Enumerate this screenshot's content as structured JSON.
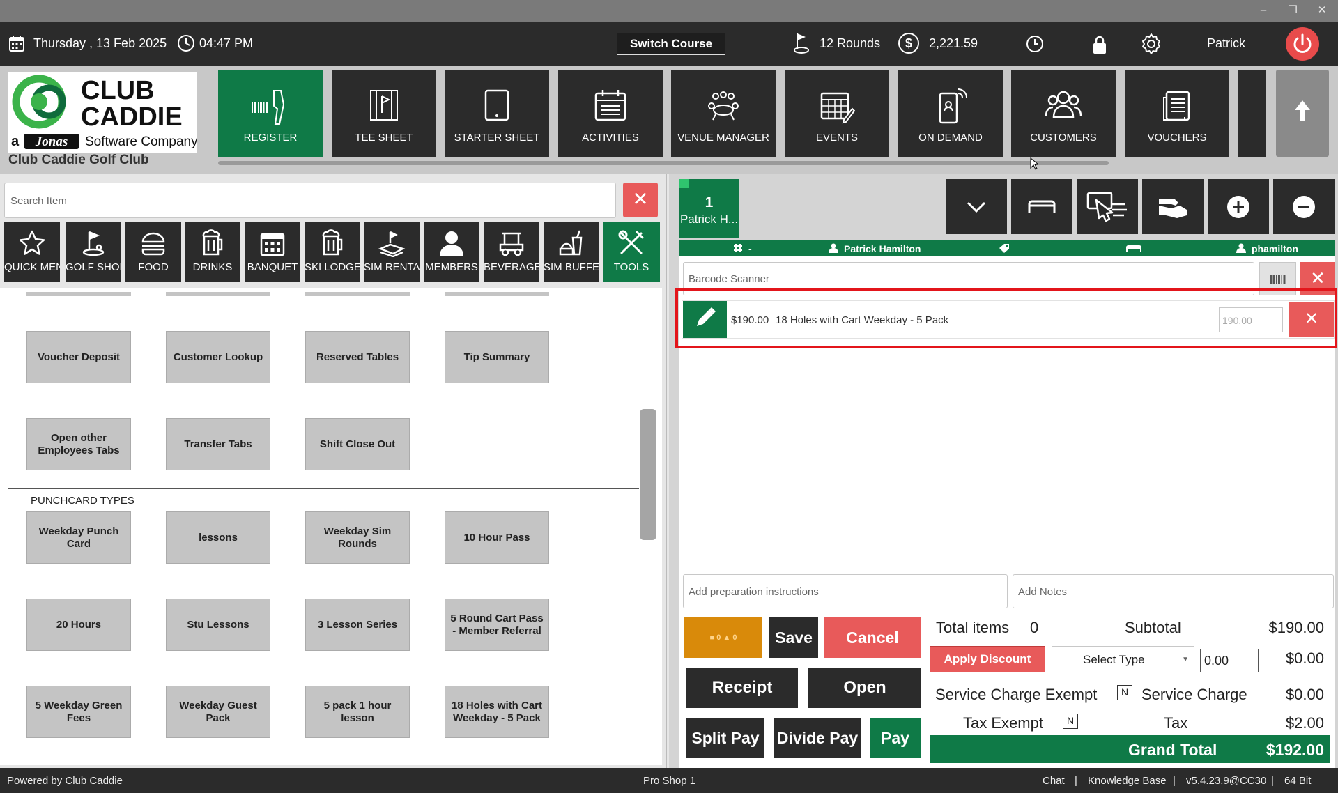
{
  "topbar": {
    "date": "Thursday ,  13 Feb 2025",
    "time": "04:47 PM",
    "switch_course": "Switch Course",
    "rounds": "12 Rounds",
    "amount": "2,221.59",
    "user": "Patrick"
  },
  "logo": {
    "line1": "CLUB",
    "line2": "CADDIE",
    "tagline_a": "a",
    "tagline_brand": "Jonas",
    "tagline_rest": "Software Company"
  },
  "club_name": "Club Caddie Golf Club",
  "nav": [
    {
      "label": "REGISTER",
      "icon": "barcode-scanner-icon"
    },
    {
      "label": "TEE SHEET",
      "icon": "flag-sheet-icon"
    },
    {
      "label": "STARTER SHEET",
      "icon": "tablet-icon"
    },
    {
      "label": "ACTIVITIES",
      "icon": "calendar-list-icon"
    },
    {
      "label": "VENUE MANAGER",
      "icon": "meeting-table-icon"
    },
    {
      "label": "EVENTS",
      "icon": "calendar-edit-icon"
    },
    {
      "label": "ON DEMAND",
      "icon": "mobile-signal-icon"
    },
    {
      "label": "CUSTOMERS",
      "icon": "people-group-icon"
    },
    {
      "label": "VOUCHERS",
      "icon": "voucher-list-icon"
    }
  ],
  "search": {
    "placeholder": "Search Item"
  },
  "categories": [
    {
      "label": "QUICK MENU",
      "icon": "star-icon"
    },
    {
      "label": "GOLF SHOP",
      "icon": "golf-icon"
    },
    {
      "label": "FOOD",
      "icon": "burger-icon"
    },
    {
      "label": "DRINKS",
      "icon": "beer-mug-icon"
    },
    {
      "label": "BANQUET",
      "icon": "calendar-grid-icon"
    },
    {
      "label": "SKI LODGE",
      "icon": "beer-mug-icon"
    },
    {
      "label": "SIM RENTAL",
      "icon": "sim-icon"
    },
    {
      "label": "MEMBERS",
      "icon": "person-icon"
    },
    {
      "label": "BEVERAGE",
      "icon": "golf-cart-icon"
    },
    {
      "label": "SIM BUFFET",
      "icon": "buffet-icon"
    },
    {
      "label": "TOOLS",
      "icon": "tools-icon"
    }
  ],
  "tools": [
    "Voucher Deposit",
    "Customer Lookup",
    "Reserved Tables",
    "Tip Summary",
    "Open other Employees Tabs",
    "Transfer Tabs",
    "Shift Close Out"
  ],
  "punchcard_label": "PUNCHCARD TYPES",
  "punchcards": [
    "Weekday Punch Card",
    "lessons",
    "Weekday Sim Rounds",
    "10 Hour Pass",
    "20 Hours",
    "Stu Lessons",
    "3 Lesson Series",
    "5 Round Cart Pass - Member Referral",
    "5 Weekday Green Fees",
    "Weekday Guest Pack",
    "5 pack 1 hour lesson",
    "18 Holes with Cart Weekday - 5 Pack"
  ],
  "order": {
    "tab_number": "1",
    "tab_name": "Patrick H...",
    "header_number": "-",
    "header_customer": "Patrick Hamilton",
    "header_user": "phamilton",
    "barcode_placeholder": "Barcode Scanner",
    "items": [
      {
        "price": "$190.00",
        "description": "18 Holes with Cart Weekday - 5 Pack",
        "amount": "190.00"
      }
    ],
    "prep_placeholder": "Add preparation instructions",
    "notes_placeholder": "Add Notes"
  },
  "buttons": {
    "loyalty_a": "0",
    "loyalty_b": "0",
    "save": "Save",
    "cancel": "Cancel",
    "receipt": "Receipt",
    "open": "Open",
    "split_pay": "Split Pay",
    "divide_pay": "Divide Pay",
    "pay": "Pay"
  },
  "summary": {
    "total_items_label": "Total items",
    "total_items": "0",
    "subtotal_label": "Subtotal",
    "subtotal": "$190.00",
    "apply_discount": "Apply Discount",
    "select_type": "Select Type",
    "discount_input": "0.00",
    "discount_value": "$0.00",
    "service_charge_exempt_label": "Service Charge Exempt",
    "service_charge_exempt": "N",
    "service_charge_label": "Service Charge",
    "service_charge": "$0.00",
    "tax_exempt_label": "Tax Exempt",
    "tax_exempt": "N",
    "tax_label": "Tax",
    "tax": "$2.00",
    "grand_total_label": "Grand Total",
    "grand_total": "$192.00"
  },
  "status": {
    "left": "Powered by Club Caddie",
    "center": "Pro Shop 1",
    "chat": "Chat",
    "kb": "Knowledge Base",
    "version": "v5.4.23.9@CC30",
    "bits": "64 Bit",
    "sep": "|"
  },
  "colors": {
    "brand_green": "#0f7a47",
    "dark": "#2b2b2b",
    "danger": "#e85a5a",
    "highlight": "#e3151b"
  }
}
